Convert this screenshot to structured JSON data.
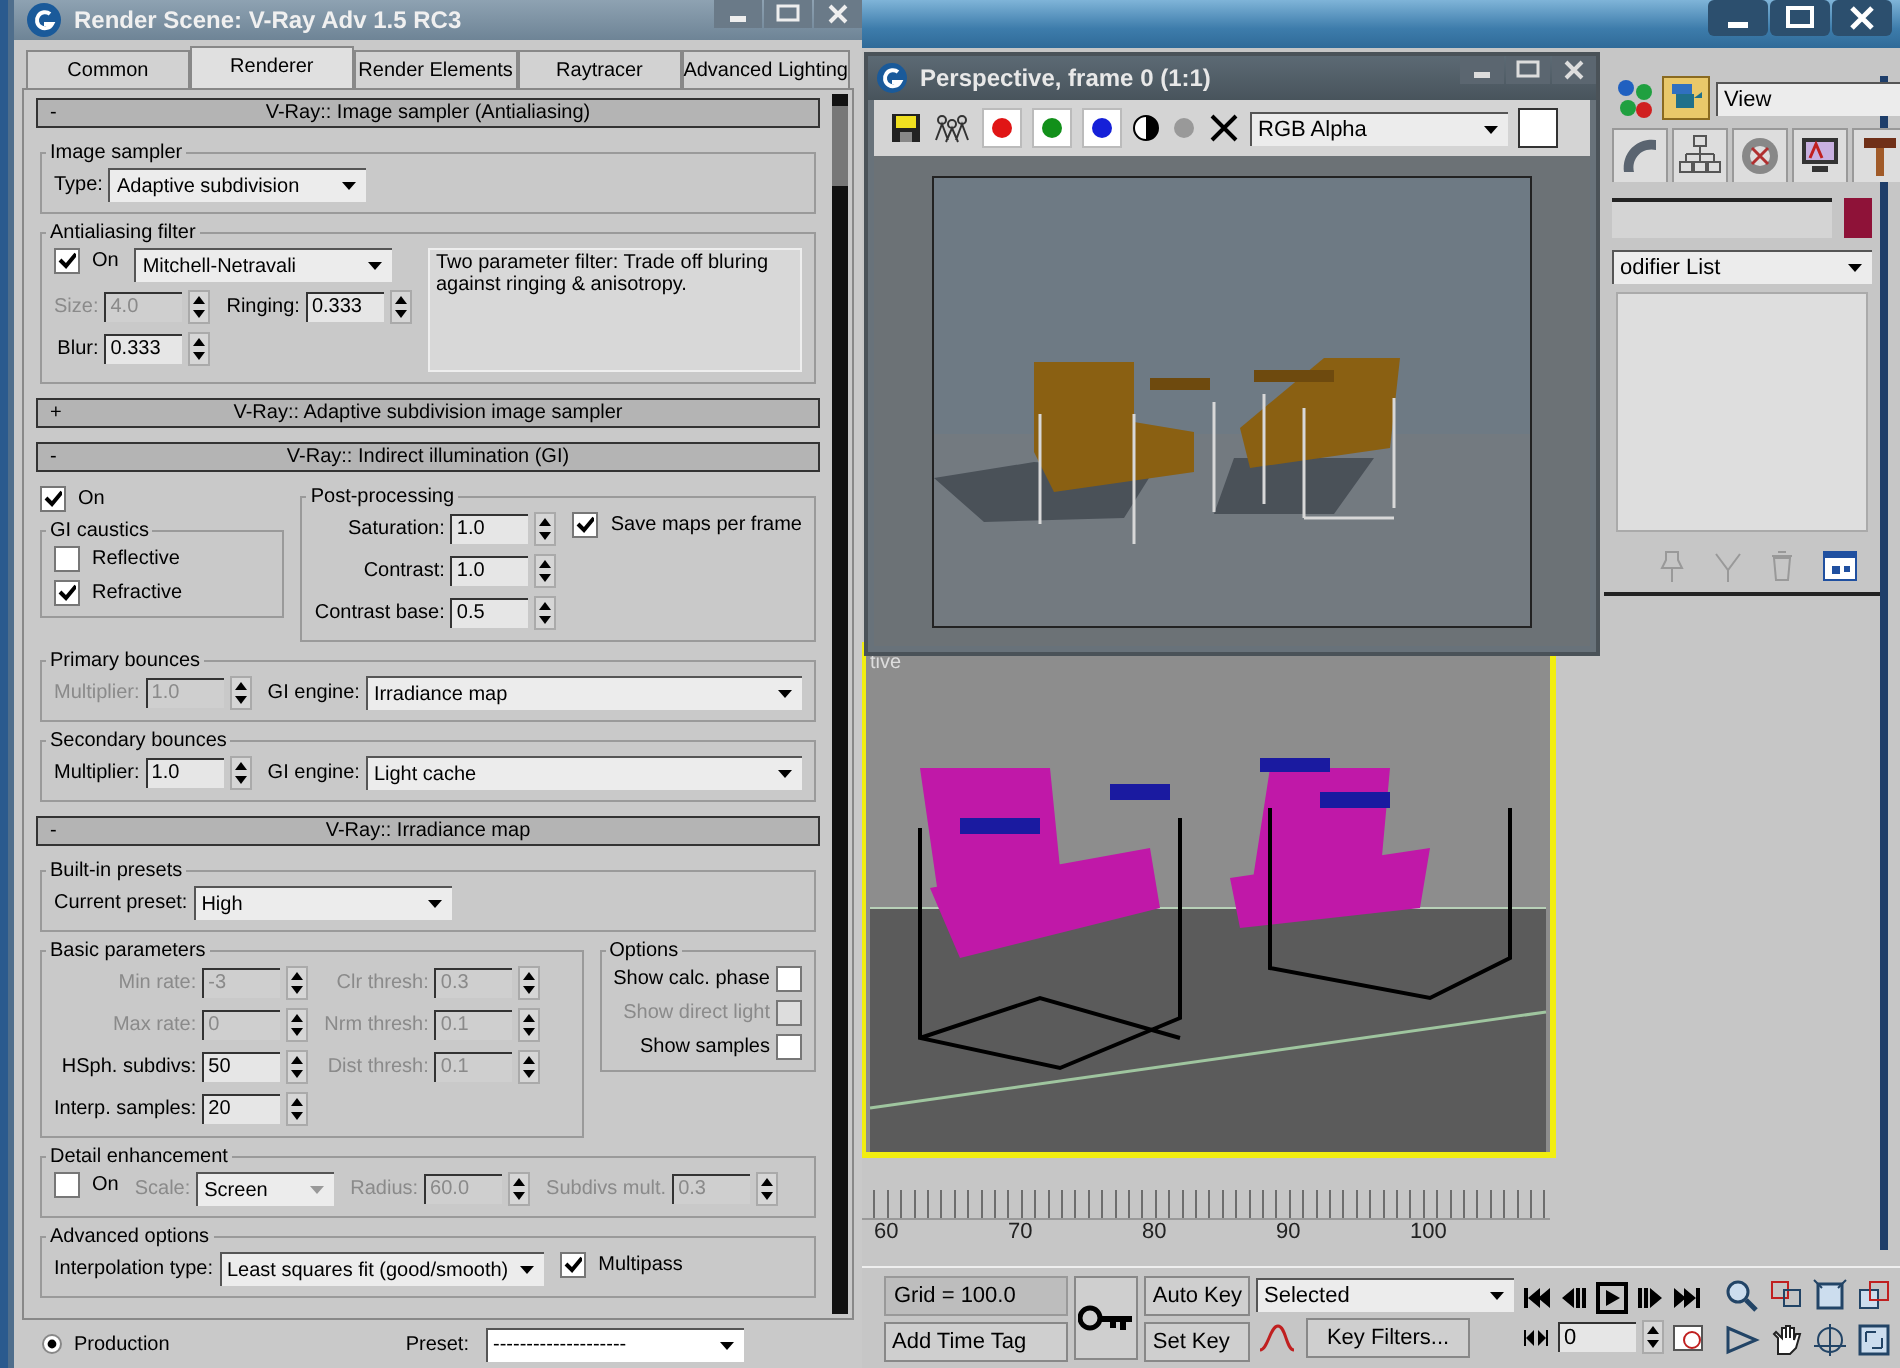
{
  "render_dialog": {
    "title": "Render Scene: V-Ray Adv 1.5 RC3",
    "tabs": [
      {
        "label": "Common",
        "selected": false
      },
      {
        "label": "Renderer",
        "selected": true
      },
      {
        "label": "Render Elements",
        "selected": false
      },
      {
        "label": "Raytracer",
        "selected": false
      },
      {
        "label": "Advanced Lighting",
        "selected": false
      }
    ],
    "rollouts": [
      {
        "sign": "-",
        "title": "V-Ray:: Image sampler (Antialiasing)",
        "content": [
          {
            "kind": "group",
            "title": "Image sampler",
            "content": [
              {
                "kind": "hbox",
                "content": [
                  {
                    "kind": "dropdown",
                    "label": "Type:",
                    "value": "Adaptive subdivision",
                    "disabled": false
                  }
                ]
              }
            ]
          },
          {
            "kind": "group",
            "title": "Antialiasing filter",
            "content": [
              {
                "kind": "hbox",
                "content": [
                  {
                    "kind": "vbox",
                    "content": [
                      {
                        "kind": "hbox",
                        "content": [
                          {
                            "kind": "checkbox",
                            "label": "On",
                            "checked": true,
                            "disabled": false
                          },
                          {
                            "kind": "dropdown",
                            "value": "Mitchell-Netravali",
                            "disabled": false
                          }
                        ]
                      },
                      {
                        "kind": "hbox",
                        "content": [
                          {
                            "kind": "form",
                            "content": [
                              {
                                "kind": "spinner",
                                "label": "Size:",
                                "value": "4.0",
                                "disabled": true
                              },
                              {
                                "kind": "spinner",
                                "label": "Blur:",
                                "value": "0.333",
                                "disabled": false
                              }
                            ]
                          },
                          {
                            "kind": "form",
                            "content": [
                              {
                                "kind": "spinner",
                                "label": "Ringing:",
                                "value": "0.333",
                                "disabled": false
                              }
                            ]
                          }
                        ]
                      }
                    ]
                  },
                  {
                    "kind": "note",
                    "text": "Two parameter filter: Trade off bluring against ringing & anisotropy."
                  }
                ]
              }
            ]
          }
        ]
      },
      {
        "sign": "+",
        "title": "V-Ray:: Adaptive subdivision image sampler"
      },
      {
        "sign": "-",
        "title": "V-Ray:: Indirect illumination (GI)",
        "content": [
          {
            "kind": "hbox",
            "content": [
              {
                "kind": "vbox",
                "content": [
                  {
                    "kind": "checkbox",
                    "label": "On",
                    "checked": true,
                    "disabled": false
                  },
                  {
                    "kind": "group",
                    "title": "GI caustics",
                    "content": [
                      {
                        "kind": "checkbox",
                        "label": "Reflective",
                        "checked": false,
                        "disabled": false
                      },
                      {
                        "kind": "checkbox",
                        "label": "Refractive",
                        "checked": true,
                        "disabled": false
                      }
                    ]
                  }
                ]
              },
              {
                "kind": "group",
                "title": "Post-processing",
                "content": [
                  {
                    "kind": "hbox",
                    "content": [
                      {
                        "kind": "form",
                        "content": [
                          {
                            "kind": "spinner",
                            "label": "Saturation:",
                            "value": "1.0",
                            "disabled": false
                          },
                          {
                            "kind": "spinner",
                            "label": "Contrast:",
                            "value": "1.0",
                            "disabled": false
                          },
                          {
                            "kind": "spinner",
                            "label": "Contrast base:",
                            "value": "0.5",
                            "disabled": false
                          }
                        ]
                      },
                      {
                        "kind": "checkbox",
                        "label": "Save maps per frame",
                        "checked": true,
                        "disabled": false
                      }
                    ]
                  }
                ]
              }
            ]
          },
          {
            "kind": "group",
            "title": "Primary bounces",
            "content": [
              {
                "kind": "hbox",
                "content": [
                  {
                    "kind": "form",
                    "content": [
                      {
                        "kind": "spinner",
                        "label": "Multiplier:",
                        "value": "1.0",
                        "disabled": true
                      }
                    ]
                  },
                  {
                    "kind": "form",
                    "content": [
                      {
                        "kind": "dropdown",
                        "label": "GI engine:",
                        "value": "Irradiance map",
                        "disabled": false
                      }
                    ]
                  }
                ]
              }
            ]
          },
          {
            "kind": "group",
            "title": "Secondary bounces",
            "content": [
              {
                "kind": "hbox",
                "content": [
                  {
                    "kind": "form",
                    "content": [
                      {
                        "kind": "spinner",
                        "label": "Multiplier:",
                        "value": "1.0",
                        "disabled": false
                      }
                    ]
                  },
                  {
                    "kind": "form",
                    "content": [
                      {
                        "kind": "dropdown",
                        "label": "GI engine:",
                        "value": "Light cache",
                        "disabled": false
                      }
                    ]
                  }
                ]
              }
            ]
          }
        ]
      },
      {
        "sign": "-",
        "title": "V-Ray:: Irradiance map",
        "content": [
          {
            "kind": "group",
            "title": "Built-in presets",
            "content": [
              {
                "kind": "hbox",
                "content": [
                  {
                    "kind": "form",
                    "content": [
                      {
                        "kind": "dropdown",
                        "label": "Current preset:",
                        "value": "High",
                        "disabled": false
                      }
                    ]
                  }
                ]
              }
            ]
          },
          {
            "kind": "hbox",
            "content": [
              {
                "kind": "group",
                "title": "Basic parameters",
                "content": [
                  {
                    "kind": "hbox",
                    "content": [
                      {
                        "kind": "form",
                        "content": [
                          {
                            "kind": "spinner",
                            "label": "Min rate:",
                            "value": "-3",
                            "disabled": true
                          },
                          {
                            "kind": "spinner",
                            "label": "Max rate:",
                            "value": "0",
                            "disabled": true
                          },
                          {
                            "kind": "spinner",
                            "label": "HSph. subdivs:",
                            "value": "50",
                            "disabled": false
                          },
                          {
                            "kind": "spinner",
                            "label": "Interp. samples:",
                            "value": "20",
                            "disabled": false
                          }
                        ]
                      },
                      {
                        "kind": "form",
                        "content": [
                          {
                            "kind": "spinner",
                            "label": "Clr thresh:",
                            "value": "0.3",
                            "disabled": true
                          },
                          {
                            "kind": "spinner",
                            "label": "Nrm thresh:",
                            "value": "0.1",
                            "disabled": true
                          },
                          {
                            "kind": "spinner",
                            "label": "Dist thresh:",
                            "value": "0.1",
                            "disabled": true
                          }
                        ]
                      }
                    ]
                  }
                ]
              },
              {
                "kind": "group",
                "title": "Options",
                "content": [
                  {
                    "kind": "form",
                    "content": [
                      {
                        "kind": "checkbox",
                        "label": "Show calc. phase",
                        "checked": false,
                        "disabled": false
                      },
                      {
                        "kind": "checkbox",
                        "label": "Show direct light",
                        "checked": false,
                        "disabled": true
                      },
                      {
                        "kind": "checkbox",
                        "label": "Show samples",
                        "checked": false,
                        "disabled": false
                      }
                    ]
                  }
                ]
              }
            ]
          },
          {
            "kind": "group",
            "title": "Detail enhancement",
            "content": [
              {
                "kind": "hbox",
                "content": [
                  {
                    "kind": "checkbox",
                    "label": "On",
                    "checked": false,
                    "disabled": false
                  },
                  {
                    "kind": "dropdown",
                    "label": "Scale:",
                    "value": "Screen",
                    "disabled": true
                  },
                  {
                    "kind": "spinner",
                    "label": "Radius:",
                    "value": "60.0",
                    "disabled": true
                  },
                  {
                    "kind": "spinner",
                    "label": "Subdivs mult.",
                    "value": "0.3",
                    "disabled": true
                  }
                ]
              }
            ]
          },
          {
            "kind": "group",
            "title": "Advanced options",
            "content": [
              {
                "kind": "hbox",
                "content": [
                  {
                    "kind": "dropdown",
                    "label": "Interpolation type:",
                    "value": "Least squares fit (good/smooth)",
                    "disabled": false
                  },
                  {
                    "kind": "checkbox",
                    "label": "Multipass",
                    "checked": true,
                    "disabled": false
                  }
                ]
              }
            ]
          }
        ]
      }
    ],
    "footer": {
      "modes": [
        {
          "label": "Production",
          "selected": true
        }
      ],
      "preset_label": "Preset:",
      "preset_value": "--------------------"
    }
  },
  "frame_window": {
    "title": "Perspective, frame 0 (1:1)",
    "channels": [
      {
        "color": "#e01515"
      },
      {
        "color": "#12901a"
      },
      {
        "color": "#1520d8"
      }
    ],
    "display": "RGB Alpha"
  },
  "viewport": {
    "label": "tive"
  },
  "command_panel": {
    "view": "View",
    "modifier_list": "odifier List"
  },
  "timeline": {
    "ticks": [
      "60",
      "70",
      "80",
      "90",
      "100"
    ]
  },
  "status_bar": {
    "grid": "Grid = 100.0",
    "time_tag": "Add Time Tag",
    "auto_key": "Auto Key",
    "set_key": "Set Key",
    "key_mode": "Selected",
    "key_filters": "Key Filters...",
    "frame": "0"
  }
}
